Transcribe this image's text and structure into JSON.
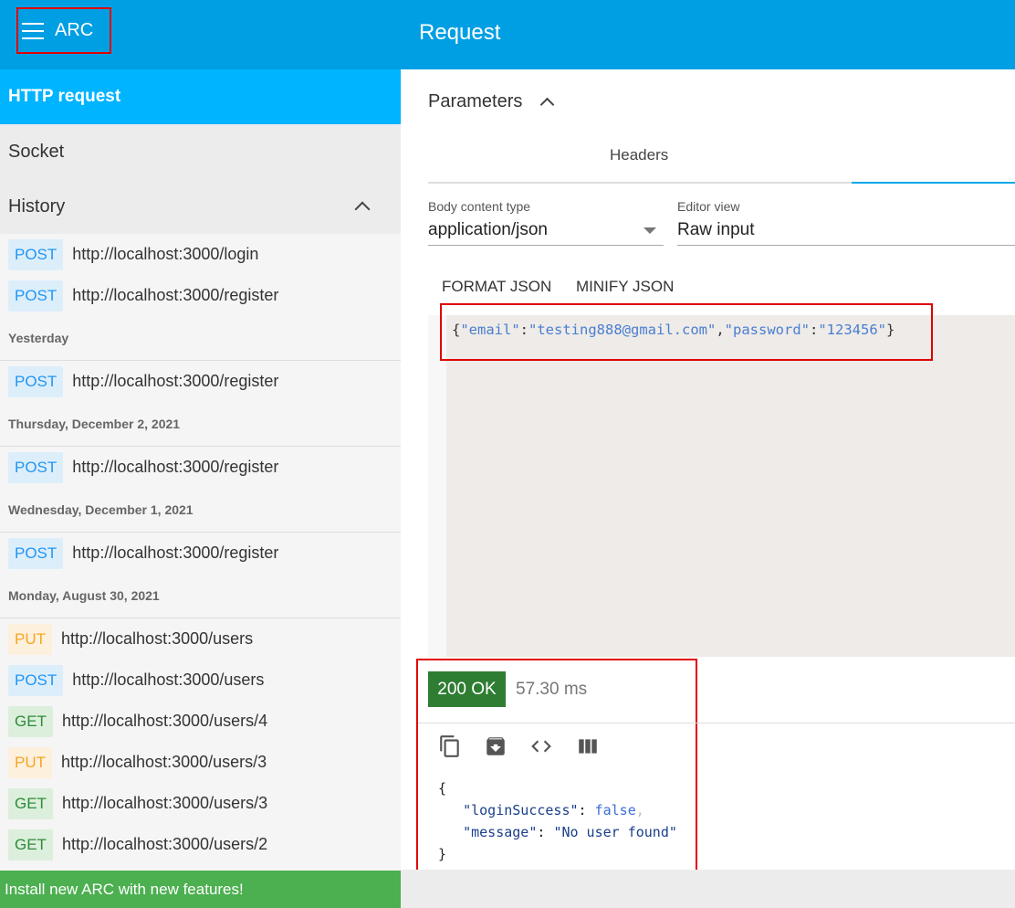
{
  "app": {
    "name": "ARC",
    "menu_icon": "hamburger-menu-icon"
  },
  "header": {
    "title": "Request"
  },
  "sidebar": {
    "nav": {
      "http_request": "HTTP request",
      "socket": "Socket",
      "history": "History"
    },
    "history_groups": [
      {
        "date": "",
        "items": [
          {
            "method": "POST",
            "url": "http://localhost:3000/login"
          },
          {
            "method": "POST",
            "url": "http://localhost:3000/register"
          }
        ]
      },
      {
        "date": "Yesterday",
        "items": [
          {
            "method": "POST",
            "url": "http://localhost:3000/register"
          }
        ]
      },
      {
        "date": "Thursday, December 2, 2021",
        "items": [
          {
            "method": "POST",
            "url": "http://localhost:3000/register"
          }
        ]
      },
      {
        "date": "Wednesday, December 1, 2021",
        "items": [
          {
            "method": "POST",
            "url": "http://localhost:3000/register"
          }
        ]
      },
      {
        "date": "Monday, August 30, 2021",
        "items": [
          {
            "method": "PUT",
            "url": "http://localhost:3000/users"
          },
          {
            "method": "POST",
            "url": "http://localhost:3000/users"
          },
          {
            "method": "GET",
            "url": "http://localhost:3000/users/4"
          },
          {
            "method": "PUT",
            "url": "http://localhost:3000/users/3"
          },
          {
            "method": "GET",
            "url": "http://localhost:3000/users/3"
          },
          {
            "method": "GET",
            "url": "http://localhost:3000/users/2"
          }
        ]
      }
    ],
    "banner": "Install new ARC with new features!"
  },
  "main": {
    "parameters_label": "Parameters",
    "tab_headers": "Headers",
    "body_content_type": {
      "label": "Body content type",
      "value": "application/json"
    },
    "editor_view": {
      "label": "Editor view",
      "value": "Raw input"
    },
    "format_json": "FORMAT JSON",
    "minify_json": "MINIFY JSON",
    "body": {
      "open": "{",
      "k1": "\"email\"",
      "colon1": ":",
      "v1": "\"testing888@gmail.com\"",
      "comma": ",",
      "k2": "\"password\"",
      "colon2": ":",
      "v2": "\"123456\"",
      "close": "}"
    }
  },
  "response": {
    "status": "200 OK",
    "time": "57.30 ms",
    "icons": [
      "copy-icon",
      "save-icon",
      "code-view-icon",
      "columns-icon"
    ],
    "json": {
      "open": "{",
      "k1": "\"loginSuccess\"",
      "v1": "false",
      "k2": "\"message\"",
      "v2": "\"No user found\"",
      "close": "}"
    }
  }
}
